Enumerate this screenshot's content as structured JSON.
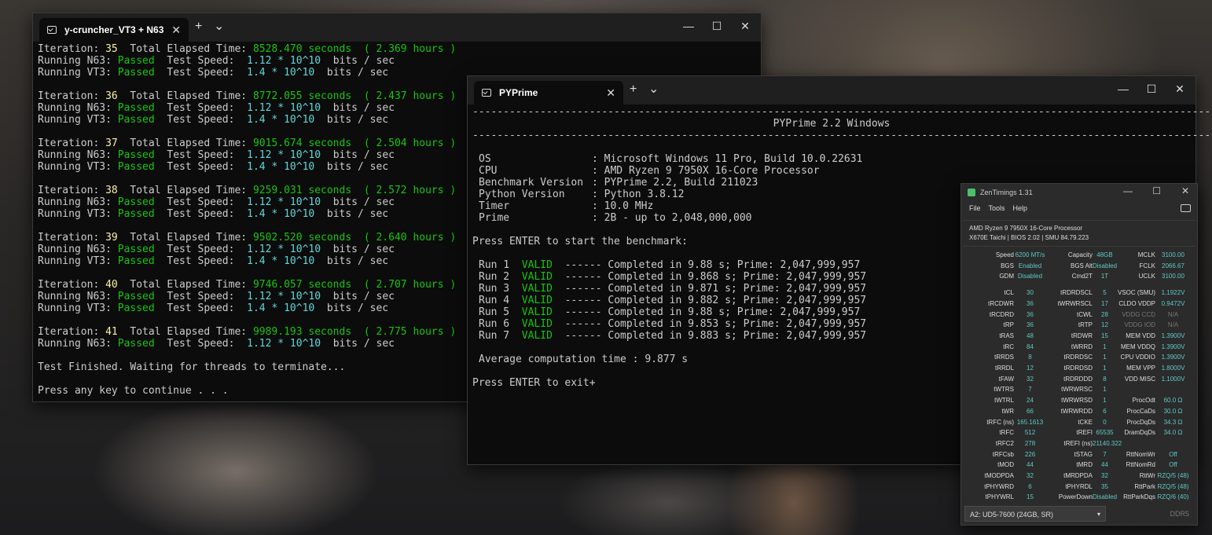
{
  "win1": {
    "tab_title": "y-cruncher_VT3 + N63",
    "plus": "+",
    "chev": "⌄",
    "close": "✕",
    "min": "—",
    "max": "☐",
    "x": "✕",
    "iterations": [
      {
        "num": "35",
        "time": "8528.470 seconds",
        "hours": "( 2.369 hours )"
      },
      {
        "num": "36",
        "time": "8772.055 seconds",
        "hours": "( 2.437 hours )"
      },
      {
        "num": "37",
        "time": "9015.674 seconds",
        "hours": "( 2.504 hours )"
      },
      {
        "num": "38",
        "time": "9259.031 seconds",
        "hours": "( 2.572 hours )"
      },
      {
        "num": "39",
        "time": "9502.520 seconds",
        "hours": "( 2.640 hours )"
      },
      {
        "num": "40",
        "time": "9746.057 seconds",
        "hours": "( 2.707 hours )"
      },
      {
        "num": "41",
        "time": "9989.193 seconds",
        "hours": "( 2.775 hours )"
      }
    ],
    "iter_label": "Iteration: ",
    "total_label": "  Total Elapsed Time: ",
    "n63_label": "Running N63: ",
    "vt3_label": "Running VT3: ",
    "passed": "Passed",
    "speed_label": "  Test Speed:  ",
    "n63_speed": "1.12 * 10^10",
    "vt3_speed": "1.4 * 10^10",
    "n63_units": "  bits / sec",
    "vt3_units": "  bits / sec",
    "finished": "Test Finished. Waiting for threads to terminate...",
    "press_key": "Press any key to continue . . ."
  },
  "win2": {
    "tab_title": "PYPrime",
    "plus": "+",
    "chev": "⌄",
    "close": "✕",
    "min": "—",
    "max": "☐",
    "x": "✕",
    "rule": "------------------------------------------------------------------------------------------------------------------------",
    "heading": "PYPrime 2.2 Windows",
    "info": [
      {
        "k": "OS",
        "v": "Microsoft Windows 11 Pro, Build 10.0.22631"
      },
      {
        "k": "CPU",
        "v": "AMD Ryzen 9 7950X 16-Core Processor"
      },
      {
        "k": "Benchmark Version",
        "v": "PYPrime 2.2, Build 211023"
      },
      {
        "k": "Python Version",
        "v": "Python 3.8.12"
      },
      {
        "k": "Timer",
        "v": "10.0 MHz"
      },
      {
        "k": "Prime",
        "v": "2B - up to 2,048,000,000"
      }
    ],
    "press_start": "Press ENTER to start the benchmark:",
    "runs": [
      {
        "run": "Run 1",
        "status": "VALID",
        "rest": "------ Completed in 9.88 s; Prime: 2,047,999,957"
      },
      {
        "run": "Run 2",
        "status": "VALID",
        "rest": "------ Completed in 9.868 s; Prime: 2,047,999,957"
      },
      {
        "run": "Run 3",
        "status": "VALID",
        "rest": "------ Completed in 9.871 s; Prime: 2,047,999,957"
      },
      {
        "run": "Run 4",
        "status": "VALID",
        "rest": "------ Completed in 9.882 s; Prime: 2,047,999,957"
      },
      {
        "run": "Run 5",
        "status": "VALID",
        "rest": "------ Completed in 9.88 s; Prime: 2,047,999,957"
      },
      {
        "run": "Run 6",
        "status": "VALID",
        "rest": "------ Completed in 9.853 s; Prime: 2,047,999,957"
      },
      {
        "run": "Run 7",
        "status": "VALID",
        "rest": "------ Completed in 9.883 s; Prime: 2,047,999,957"
      }
    ],
    "average": "Average computation time : 9.877 s",
    "press_exit": "Press ENTER to exit+"
  },
  "zt": {
    "title": "ZenTimings 1.31",
    "min": "—",
    "max": "☐",
    "x": "✕",
    "menu": [
      "File",
      "Tools",
      "Help"
    ],
    "cpu": "AMD Ryzen 9 7950X 16-Core Processor",
    "board": "X670E Taichi | BIOS 2.02 | SMU 84.79.223",
    "top_rows": [
      [
        "Speed",
        "6200 MT/s",
        "Capacity",
        "48GB",
        "MCLK",
        "3100.00"
      ],
      [
        "BGS",
        "Enabled",
        "BGS Alt",
        "Disabled",
        "FCLK",
        "2066.67"
      ],
      [
        "GDM",
        "Disabled",
        "Cmd2T",
        "1T",
        "UCLK",
        "3100.00"
      ]
    ],
    "rows": [
      [
        "tCL",
        "30",
        "tRDRDSCL",
        "5",
        "VSOC (SMU)",
        "1.1922V"
      ],
      [
        "tRCDWR",
        "36",
        "tWRWRSCL",
        "17",
        "CLDO VDDP",
        "0.9472V"
      ],
      [
        "tRCDRD",
        "36",
        "tCWL",
        "28",
        "VDDG CCD",
        "N/A"
      ],
      [
        "tRP",
        "36",
        "tRTP",
        "12",
        "VDDG IOD",
        "N/A"
      ],
      [
        "tRAS",
        "48",
        "tRDWR",
        "15",
        "MEM VDD",
        "1.3900V"
      ],
      [
        "tRC",
        "84",
        "tWRRD",
        "1",
        "MEM VDDQ",
        "1.3900V"
      ],
      [
        "tRRDS",
        "8",
        "tRDRDSC",
        "1",
        "CPU VDDIO",
        "1.3900V"
      ],
      [
        "tRRDL",
        "12",
        "tRDRDSD",
        "1",
        "MEM VPP",
        "1.8000V"
      ],
      [
        "tFAW",
        "32",
        "tRDRDDD",
        "8",
        "VDD MISC",
        "1.1000V"
      ],
      [
        "tWTRS",
        "7",
        "tWRWRSC",
        "1",
        "",
        ""
      ],
      [
        "tWTRL",
        "24",
        "tWRWRSD",
        "1",
        "ProcOdt",
        "60.0 Ω"
      ],
      [
        "tWR",
        "66",
        "tWRWRDD",
        "6",
        "ProcCaDs",
        "30.0 Ω"
      ],
      [
        "tRFC (ns)",
        "165.1613",
        "tCKE",
        "0",
        "ProcDqDs",
        "34.3 Ω"
      ],
      [
        "tRFC",
        "512",
        "tREFI",
        "65535",
        "DramDqDs",
        "34.0 Ω"
      ],
      [
        "tRFC2",
        "278",
        "tREFI (ns)",
        "21140.322",
        "",
        ""
      ],
      [
        "tRFCsb",
        "226",
        "tSTAG",
        "7",
        "RttNomWr",
        "Off"
      ],
      [
        "tMOD",
        "44",
        "tMRD",
        "44",
        "RttNomRd",
        "Off"
      ],
      [
        "tMODPDA",
        "32",
        "tMRDPDA",
        "32",
        "RttWr",
        "RZQ/5 (48)"
      ],
      [
        "tPHYWRD",
        "6",
        "tPHYRDL",
        "35",
        "RttPark",
        "RZQ/5 (48)"
      ],
      [
        "tPHYWRL",
        "15",
        "PowerDown",
        "Disabled",
        "RttParkDqs",
        "RZQ/6 (40)"
      ]
    ],
    "dimm": "A2: UD5-7600 (24GB, SR)",
    "dimm_arrow": "▾",
    "ddr": "DDR5"
  }
}
